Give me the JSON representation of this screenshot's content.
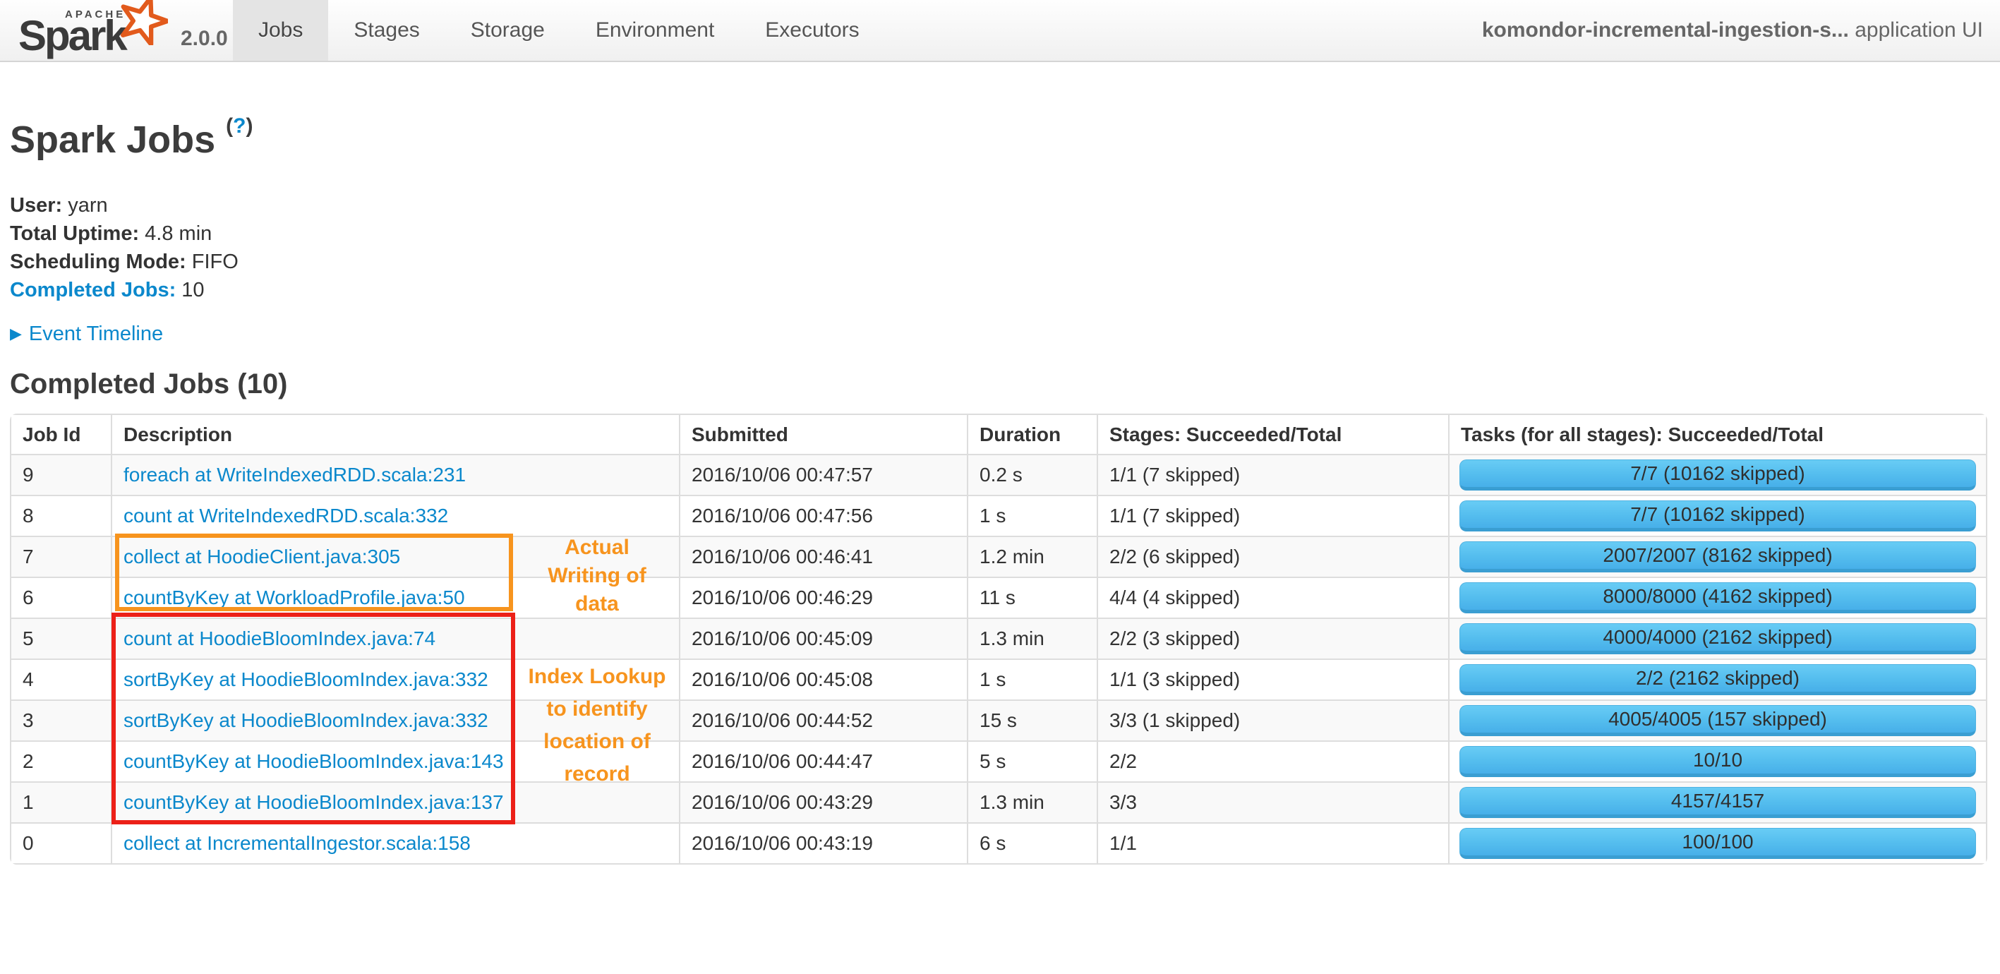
{
  "navbar": {
    "logo": {
      "apache": "APACHE",
      "name": "Spark",
      "version": "2.0.0"
    },
    "tabs": [
      {
        "label": "Jobs",
        "active": true
      },
      {
        "label": "Stages",
        "active": false
      },
      {
        "label": "Storage",
        "active": false
      },
      {
        "label": "Environment",
        "active": false
      },
      {
        "label": "Executors",
        "active": false
      }
    ],
    "app_name": "komondor-incremental-ingestion-s...",
    "app_suffix": " application UI"
  },
  "page": {
    "title": "Spark Jobs",
    "help": {
      "open": "(",
      "q": "?",
      "close": ")"
    },
    "summary": [
      {
        "key": "user",
        "label": "User:",
        "value": "yarn",
        "link": false
      },
      {
        "key": "total-uptime",
        "label": "Total Uptime:",
        "value": "4.8 min",
        "link": false
      },
      {
        "key": "scheduling-mode",
        "label": "Scheduling Mode:",
        "value": "FIFO",
        "link": false
      },
      {
        "key": "completed-jobs",
        "label": "Completed Jobs:",
        "value": "10",
        "link": true
      }
    ],
    "event_timeline": "Event Timeline",
    "event_timeline_arrow": "▶",
    "section_title": "Completed Jobs (10)"
  },
  "table": {
    "headers": [
      "Job Id",
      "Description",
      "Submitted",
      "Duration",
      "Stages: Succeeded/Total",
      "Tasks (for all stages): Succeeded/Total"
    ],
    "rows": [
      {
        "id": "9",
        "description": "foreach at WriteIndexedRDD.scala:231",
        "submitted": "2016/10/06 00:47:57",
        "duration": "0.2 s",
        "stages": "1/1 (7 skipped)",
        "tasks": "7/7 (10162 skipped)"
      },
      {
        "id": "8",
        "description": "count at WriteIndexedRDD.scala:332",
        "submitted": "2016/10/06 00:47:56",
        "duration": "1 s",
        "stages": "1/1 (7 skipped)",
        "tasks": "7/7 (10162 skipped)"
      },
      {
        "id": "7",
        "description": "collect at HoodieClient.java:305",
        "submitted": "2016/10/06 00:46:41",
        "duration": "1.2 min",
        "stages": "2/2 (6 skipped)",
        "tasks": "2007/2007 (8162 skipped)"
      },
      {
        "id": "6",
        "description": "countByKey at WorkloadProfile.java:50",
        "submitted": "2016/10/06 00:46:29",
        "duration": "11 s",
        "stages": "4/4 (4 skipped)",
        "tasks": "8000/8000 (4162 skipped)"
      },
      {
        "id": "5",
        "description": "count at HoodieBloomIndex.java:74",
        "submitted": "2016/10/06 00:45:09",
        "duration": "1.3 min",
        "stages": "2/2 (3 skipped)",
        "tasks": "4000/4000 (2162 skipped)"
      },
      {
        "id": "4",
        "description": "sortByKey at HoodieBloomIndex.java:332",
        "submitted": "2016/10/06 00:45:08",
        "duration": "1 s",
        "stages": "1/1 (3 skipped)",
        "tasks": "2/2 (2162 skipped)"
      },
      {
        "id": "3",
        "description": "sortByKey at HoodieBloomIndex.java:332",
        "submitted": "2016/10/06 00:44:52",
        "duration": "15 s",
        "stages": "3/3 (1 skipped)",
        "tasks": "4005/4005 (157 skipped)"
      },
      {
        "id": "2",
        "description": "countByKey at HoodieBloomIndex.java:143",
        "submitted": "2016/10/06 00:44:47",
        "duration": "5 s",
        "stages": "2/2",
        "tasks": "10/10"
      },
      {
        "id": "1",
        "description": "countByKey at HoodieBloomIndex.java:137",
        "submitted": "2016/10/06 00:43:29",
        "duration": "1.3 min",
        "stages": "3/3",
        "tasks": "4157/4157"
      },
      {
        "id": "0",
        "description": "collect at IncrementalIngestor.scala:158",
        "submitted": "2016/10/06 00:43:19",
        "duration": "6 s",
        "stages": "1/1",
        "tasks": "100/100"
      }
    ]
  },
  "annotations": {
    "writing": {
      "text": "Actual\nWriting of\ndata"
    },
    "index": {
      "text": "Index Lookup\nto identify\nlocation of\nrecord"
    }
  },
  "colors": {
    "link_blue": "#0b88cc",
    "annotation_orange": "#f7941e",
    "annotation_red": "#ec2018",
    "bar_top": "#68ccf5",
    "bar_bottom": "#47afe9",
    "table_border": "#dddddd",
    "stripe": "#f9f9f9"
  }
}
